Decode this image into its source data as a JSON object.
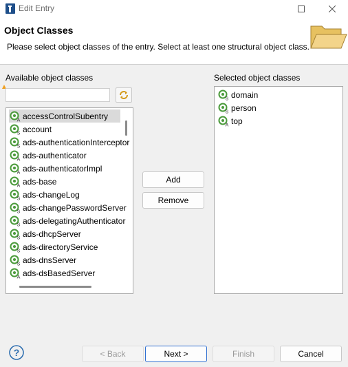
{
  "window": {
    "title": "Edit Entry"
  },
  "header": {
    "title": "Object Classes",
    "description": "Please select object classes of the entry. Select at least one structural object class."
  },
  "available": {
    "label": "Available object classes",
    "filter_value": "",
    "items": [
      "accessControlSubentry",
      "account",
      "ads-authenticationInterceptor",
      "ads-authenticator",
      "ads-authenticatorImpl",
      "ads-base",
      "ads-changeLog",
      "ads-changePasswordServer",
      "ads-delegatingAuthenticator",
      "ads-dhcpServer",
      "ads-directoryService",
      "ads-dnsServer",
      "ads-dsBasedServer"
    ],
    "item_kinds": [
      "A",
      "S",
      "S",
      "A",
      "A",
      "A",
      "S",
      "S",
      "S",
      "S",
      "S",
      "S",
      "A"
    ],
    "selected_index": 0
  },
  "actions": {
    "add_label": "Add",
    "remove_label": "Remove"
  },
  "selected": {
    "label": "Selected object classes",
    "items": [
      "domain",
      "person",
      "top"
    ],
    "item_kinds": [
      "S",
      "S",
      "A"
    ]
  },
  "footer": {
    "back_label": "< Back",
    "next_label": "Next >",
    "finish_label": "Finish",
    "cancel_label": "Cancel"
  },
  "colors": {
    "icon_green": "#4a9a3a",
    "accent_blue": "#2f6fd1"
  }
}
